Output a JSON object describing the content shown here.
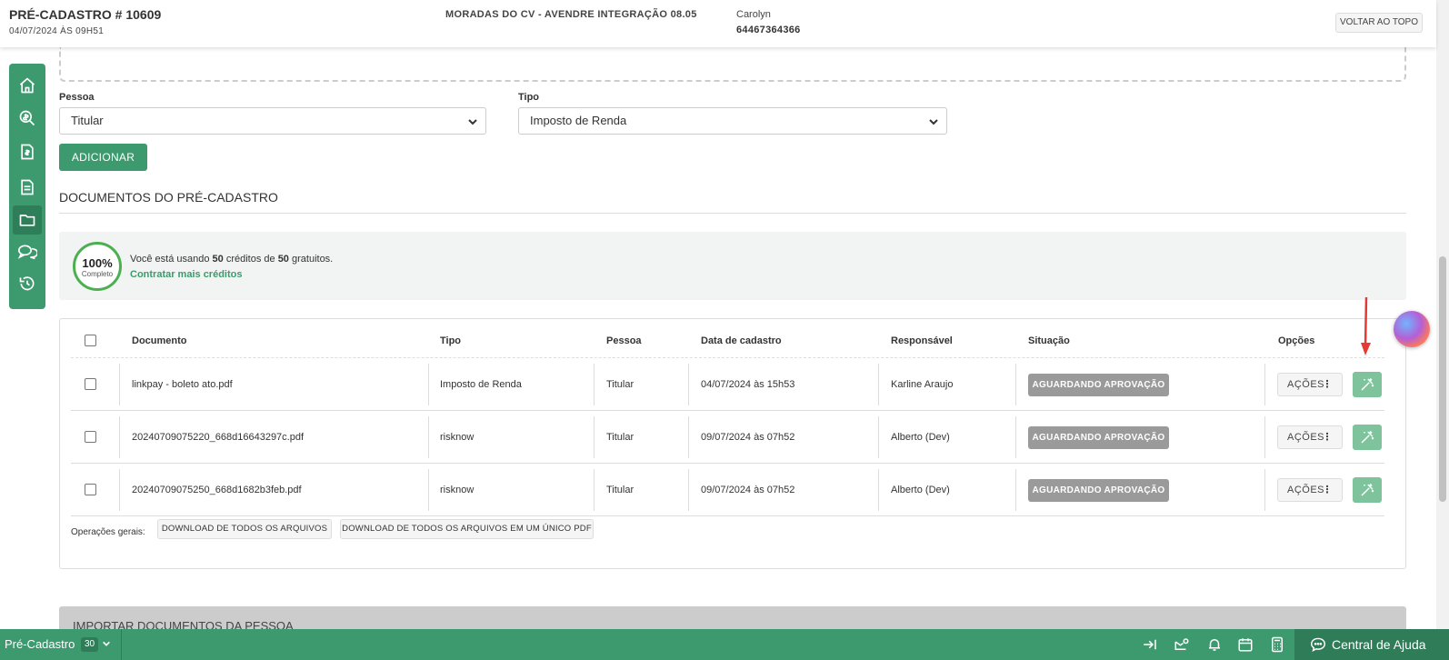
{
  "header": {
    "title": "PRÉ-CADASTRO # 10609",
    "date": "04/07/2024 ÀS 09H51",
    "company": "MORADAS DO CV - AVENDRE INTEGRAÇÃO 08.05",
    "user_name": "Carolyn",
    "user_phone": "64467364366",
    "back_to_top_label": "VOLTAR AO TOPO"
  },
  "sidebar": {
    "items": [
      {
        "icon": "home-icon"
      },
      {
        "icon": "search-money-icon"
      },
      {
        "icon": "invoice-icon"
      },
      {
        "icon": "document-icon"
      },
      {
        "icon": "folder-icon",
        "active": true
      },
      {
        "icon": "chat-icon"
      },
      {
        "icon": "history-icon"
      }
    ]
  },
  "form": {
    "pessoa_label": "Pessoa",
    "pessoa_value": "Titular",
    "tipo_label": "Tipo",
    "tipo_value": "Imposto de Renda",
    "add_label": "ADICIONAR"
  },
  "documents": {
    "section_title": "DOCUMENTOS DO PRÉ-CADASTRO",
    "credits": {
      "percent": "100%",
      "percent_label": "Completo",
      "text_prefix": "Você está usando ",
      "used": "50",
      "text_middle": " créditos de ",
      "total": "50",
      "text_suffix": " gratuitos.",
      "link_label": "Contratar mais créditos"
    },
    "columns": {
      "documento": "Documento",
      "tipo": "Tipo",
      "pessoa": "Pessoa",
      "data": "Data de cadastro",
      "responsavel": "Responsável",
      "situacao": "Situação",
      "opcoes": "Opções"
    },
    "rows": [
      {
        "documento": "linkpay - boleto ato.pdf",
        "tipo": "Imposto de Renda",
        "pessoa": "Titular",
        "data": "04/07/2024 às 15h53",
        "responsavel": "Karline Araujo",
        "situacao": "AGUARDANDO APROVAÇÃO",
        "acoes": "AÇÕES"
      },
      {
        "documento": "20240709075220_668d16643297c.pdf",
        "tipo": "risknow",
        "pessoa": "Titular",
        "data": "09/07/2024 às 07h52",
        "responsavel": "Alberto (Dev)",
        "situacao": "AGUARDANDO APROVAÇÃO",
        "acoes": "AÇÕES"
      },
      {
        "documento": "20240709075250_668d1682b3feb.pdf",
        "tipo": "risknow",
        "pessoa": "Titular",
        "data": "09/07/2024 às 07h52",
        "responsavel": "Alberto (Dev)",
        "situacao": "AGUARDANDO APROVAÇÃO",
        "acoes": "AÇÕES"
      }
    ],
    "operations_label": "Operações gerais:",
    "download_all_label": "DOWNLOAD DE TODOS OS ARQUIVOS",
    "download_pdf_label": "DOWNLOAD DE TODOS OS ARQUIVOS EM UM ÚNICO PDF"
  },
  "import_section": {
    "title": "IMPORTAR DOCUMENTOS DA PESSOA"
  },
  "bottombar": {
    "page_label": "Pré-Cadastro",
    "page_count": "30",
    "help_label": "Central de Ajuda"
  },
  "colors": {
    "brand_green": "#3c9a6e",
    "badge_gray": "#9a9a9a",
    "annotation_red": "#e53935"
  }
}
